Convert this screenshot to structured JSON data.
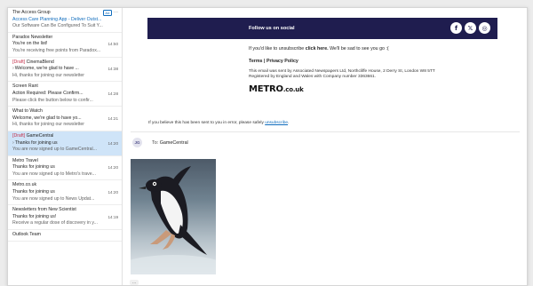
{
  "message_list": [
    {
      "sender": "The Access Group",
      "subject": "Access Care Planning App - Deliver Outst...",
      "preview": "Our Software Can Be Configured To Suit Y...",
      "badge": "Ad",
      "time": "",
      "draft": false,
      "accent_subject": true,
      "selected": false
    },
    {
      "sender": "Paradox Newsletter",
      "subject": "You're on the list!",
      "preview": "You're receiving free points from Paradox...",
      "time": "14:50",
      "draft": false,
      "selected": false
    },
    {
      "sender": "CinemaBlend",
      "subject": "Welcome, we're glad to have ...",
      "preview": "Hi, thanks for joining our newsletter",
      "time": "14:38",
      "draft": true,
      "thread": true,
      "selected": false
    },
    {
      "sender": "Screen Rant",
      "subject": "Action Required: Please Confirm...",
      "preview": "Please click the button below to confir...",
      "time": "14:28",
      "draft": false,
      "selected": false
    },
    {
      "sender": "What to Watch",
      "subject": "Welcome, we're glad to have yo...",
      "preview": "Hi, thanks for joining our newsletter",
      "time": "14:21",
      "draft": false,
      "selected": false
    },
    {
      "sender": "GameCentral",
      "subject": "Thanks for joining us",
      "preview": "You are now signed up to GameCentral...",
      "time": "14:20",
      "draft": true,
      "thread": true,
      "selected": true
    },
    {
      "sender": "Metro Travel",
      "subject": "Thanks for joining us",
      "preview": "You are now signed up to Metro's trave...",
      "time": "14:20",
      "draft": false,
      "selected": false
    },
    {
      "sender": "Metro.co.uk",
      "subject": "Thanks for joining us",
      "preview": "You are now signed up to News Updat...",
      "time": "14:20",
      "draft": false,
      "selected": false
    },
    {
      "sender": "Newsletters from New Scientist",
      "subject": "Thanks for joining us!",
      "preview": "Receive a regular dose of discovery in y...",
      "time": "14:19",
      "draft": false,
      "selected": false
    },
    {
      "sender": "Outlook Team",
      "subject": "",
      "preview": "",
      "time": "",
      "draft": false,
      "selected": false
    }
  ],
  "draft_label": "[Draft]",
  "email": {
    "social_title": "Follow us on social",
    "social_icons": [
      "facebook-icon",
      "x-icon",
      "instagram-icon"
    ],
    "social_glyphs": [
      "f",
      "𝕏",
      "◎"
    ],
    "unsubscribe_before": "If you'd like to unsubscribe ",
    "unsubscribe_link": "click here.",
    "unsubscribe_after": " We'll be sad to see you go :(",
    "terms": "Terms",
    "separator": " | ",
    "privacy": "Privacy Policy",
    "legal_line1": "This email was sent by Associated Newspapers Ltd, Northcliffe House, 2 Derry St, London W8 5TT",
    "legal_line2": "Registered by England and Wales with Company number 3363661.",
    "logo_main": "METRO",
    "logo_suffix": ".co.uk",
    "error_before": "If you believe this has been sent to you in error, please safely ",
    "error_link": "unsubscribe",
    "error_after": "."
  },
  "draft": {
    "avatar_initials": "JG",
    "to_label": "To:",
    "to_name": "GameCentral"
  },
  "see_more": "...",
  "colors": {
    "social_bar": "#1f1d4f",
    "selected_row": "#cfe4f8",
    "accent": "#0f6cbd",
    "draft_red": "#c4314b"
  }
}
